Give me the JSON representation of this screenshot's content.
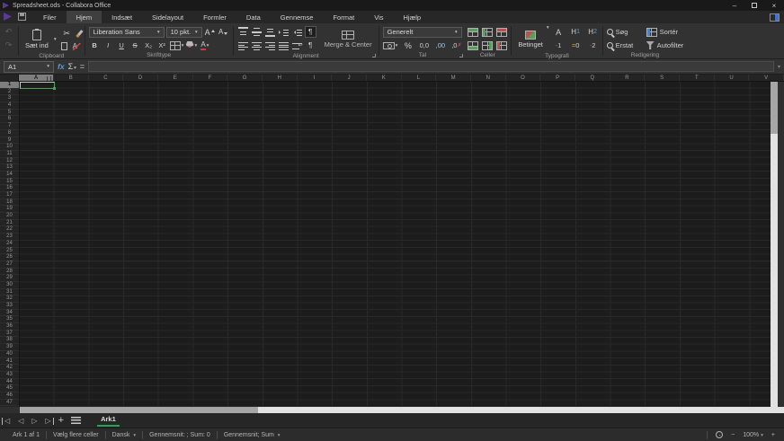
{
  "window": {
    "title": "Spreadsheet.ods - Collabora Office",
    "minimize": "–",
    "close": "×"
  },
  "menubar": {
    "tabs": [
      "Filer",
      "Hjem",
      "Indsæt",
      "Sidelayout",
      "Formler",
      "Data",
      "Gennemse",
      "Format",
      "Vis",
      "Hjælp"
    ],
    "active_tab": "Hjem"
  },
  "ribbon": {
    "undo_icon": "↶",
    "redo_icon": "↷",
    "cut_icon": "✂",
    "clipboard": {
      "paste_label": "Sæt ind",
      "group_label": "Clipboard",
      "clear_letter": "A"
    },
    "font": {
      "family": "Liberation Sans",
      "size": "10 pkt.",
      "bold": "B",
      "italic": "I",
      "underline": "U",
      "strikethrough": "S",
      "subscript": "X₂",
      "superscript": "X²",
      "grow": "A",
      "shrink": "A",
      "color_letter": "A",
      "group_label": "Skrifttype"
    },
    "alignment": {
      "pilcrow": "¶",
      "merge_label": "Merge & Center",
      "group_label": "Alignment"
    },
    "number": {
      "format_value": "Generelt",
      "percent": "%",
      "one_decimal": "0,0",
      "add_decimal": ",00",
      "del_decimal": ",0",
      "del_mark": "✗",
      "group_label": "Tal"
    },
    "cells": {
      "group_label": "Celler"
    },
    "styles": {
      "conditional_label": "Betinget",
      "default_style": "A",
      "h1_letter": "H",
      "h1_num": "1",
      "h2_letter": "H",
      "h2_num": "2",
      "good_sign": "-",
      "good_num": "1",
      "neutral_sign": "=",
      "neutral_num": "0",
      "bad_sign": "-",
      "bad_num": "2",
      "group_label": "Typografi"
    },
    "editing": {
      "search_label": "Søg",
      "sort_label": "Sortér",
      "replace_label": "Erstat",
      "autofilter_label": "Autofilter",
      "group_label": "Redigering"
    }
  },
  "formula_bar": {
    "cell_reference": "A1",
    "function_wizard": "fx",
    "sum": "Σ",
    "equals": "=",
    "input_value": ""
  },
  "grid": {
    "columns": [
      "A",
      "B",
      "C",
      "D",
      "E",
      "F",
      "G",
      "H",
      "I",
      "J",
      "K",
      "L",
      "M",
      "N",
      "O",
      "P",
      "Q",
      "R",
      "S",
      "T",
      "U",
      "V"
    ],
    "row_count": 47,
    "selected_cell": "A1",
    "selected_column": "A",
    "selected_row": "1"
  },
  "sheet_bar": {
    "nav_first": "◁",
    "nav_prev": "◁",
    "nav_next": "▷",
    "nav_last": "▷",
    "add_sheet": "+",
    "active_tab": "Ark1"
  },
  "status_bar": {
    "sheet_info": "Ark 1 af 1",
    "selection_mode": "Vælg flere celler",
    "language": "Dansk",
    "summary": "Gennemsnit: ; Sum: 0",
    "summary_selector": "Gennemsnit; Sum",
    "zoom_out": "−",
    "zoom_level": "100%",
    "zoom_in": "+"
  },
  "colors": {
    "accent_green": "#23a455",
    "brand_purple": "#5d3a91",
    "selection_handle": "#3fae4e"
  }
}
